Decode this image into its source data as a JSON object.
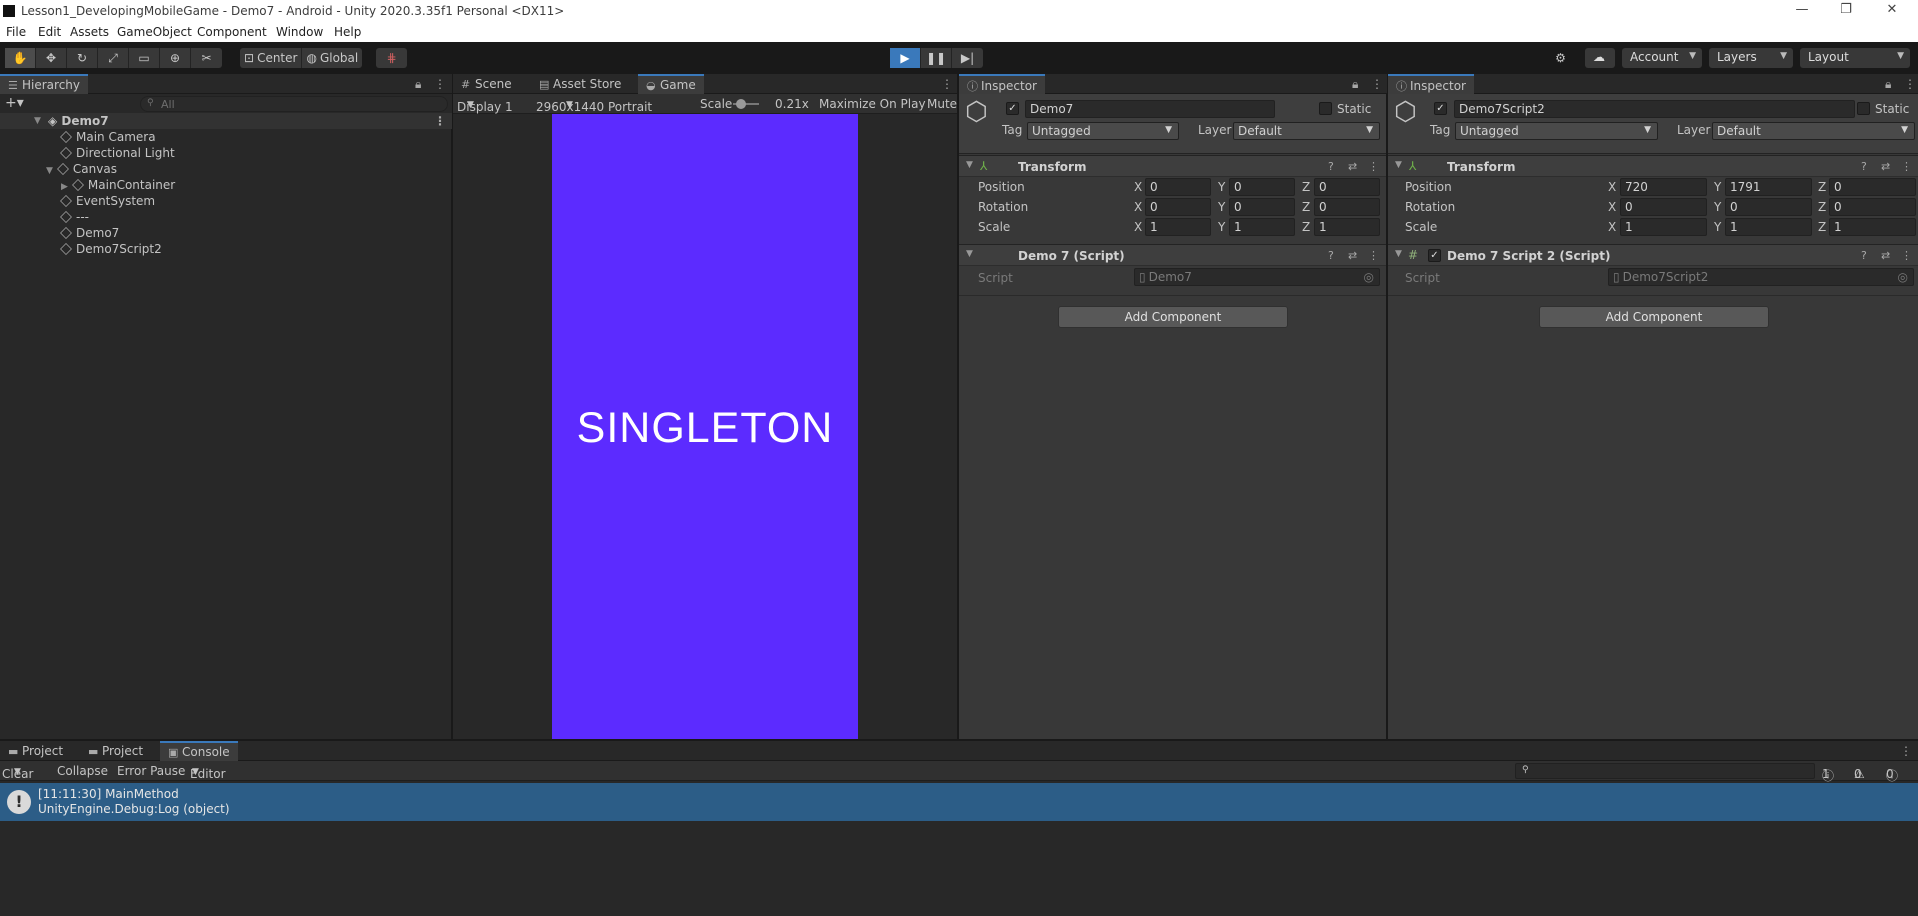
{
  "window": {
    "title": "Lesson1_DevelopingMobileGame - Demo7 - Android - Unity 2020.3.35f1 Personal <DX11>",
    "controls": [
      "—",
      "❐",
      "✕"
    ]
  },
  "menu": [
    "File",
    "Edit",
    "Assets",
    "GameObject",
    "Component",
    "Window",
    "Help"
  ],
  "toolbar": {
    "pivot": "Center",
    "space": "Global",
    "account": "Account",
    "layers": "Layers",
    "layout": "Layout"
  },
  "hierarchy": {
    "tab": "Hierarchy",
    "search_placeholder": "All",
    "scene": "Demo7",
    "items": [
      "Main Camera",
      "Directional Light",
      "Canvas",
      "MainContainer",
      "EventSystem",
      "---",
      "Demo7",
      "Demo7Script2"
    ]
  },
  "game_panel": {
    "tabs": [
      "Scene",
      "Asset Store",
      "Game"
    ],
    "display": "Display 1",
    "resolution": "2960x1440 Portrait",
    "scale_label": "Scale",
    "scale_value": "0.21x",
    "maximize": "Maximize On Play",
    "mute": "Mute",
    "screen_text": "SINGLETON",
    "screen_color": "#5c2bff"
  },
  "inspector1": {
    "tab": "Inspector",
    "name": "Demo7",
    "static": "Static",
    "tag_label": "Tag",
    "tag": "Untagged",
    "layer_label": "Layer",
    "layer": "Default",
    "transform": "Transform",
    "position_label": "Position",
    "rotation_label": "Rotation",
    "scale_label": "Scale",
    "pos": [
      "0",
      "0",
      "0"
    ],
    "rot": [
      "0",
      "0",
      "0"
    ],
    "scl": [
      "1",
      "1",
      "1"
    ],
    "script_component": "Demo 7 (Script)",
    "script_label": "Script",
    "script_value": "Demo7",
    "add_component": "Add Component"
  },
  "inspector2": {
    "tab": "Inspector",
    "name": "Demo7Script2",
    "static": "Static",
    "tag_label": "Tag",
    "tag": "Untagged",
    "layer_label": "Layer",
    "layer": "Default",
    "transform": "Transform",
    "position_label": "Position",
    "rotation_label": "Rotation",
    "scale_label": "Scale",
    "pos": [
      "720",
      "1791",
      "0"
    ],
    "rot": [
      "0",
      "0",
      "0"
    ],
    "scl": [
      "1",
      "1",
      "1"
    ],
    "script_component": "Demo 7 Script 2 (Script)",
    "script_label": "Script",
    "script_value": "Demo7Script2",
    "add_component": "Add Component"
  },
  "console": {
    "tabs": [
      "Project",
      "Project",
      "Console"
    ],
    "clear": "Clear",
    "collapse": "Collapse",
    "error_pause": "Error Pause",
    "editor": "Editor",
    "counts": {
      "log": "1",
      "warn": "0",
      "error": "0"
    },
    "log_line1": "[11:11:30] MainMethod",
    "log_line2": "UnityEngine.Debug:Log (object)"
  },
  "colors": {
    "accent": "#3a79bb",
    "log_selected": "#2c5d87"
  }
}
